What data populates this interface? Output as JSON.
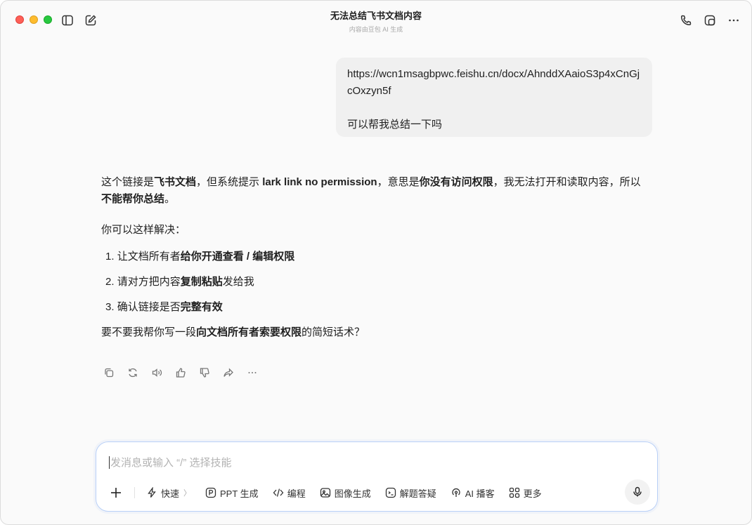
{
  "window": {
    "title": "无法总结飞书文档内容",
    "subtitle": "内容由豆包 AI 生成"
  },
  "user_message": {
    "link": "https://wcn1msagbpwc.feishu.cn/docx/AhnddXAaioS3p4xCnGjcOxzyn5f",
    "text": "可以帮我总结一下吗"
  },
  "reply": {
    "intro": {
      "t1": "这个链接是",
      "b1": "飞书文档",
      "t2": "，但系统提示 ",
      "b2": "lark link no permission",
      "t3": "，意思是",
      "b3": "你没有访问权限",
      "t4": "，我无法打开和读取内容，所以",
      "b4": "不能帮你总结",
      "t5": "。"
    },
    "how": "你可以这样解决：",
    "steps": [
      {
        "num": "1.",
        "pre": "让文档所有者",
        "bold": "给你开通查看 / 编辑权限",
        "post": ""
      },
      {
        "num": "2.",
        "pre": "请对方把内容",
        "bold": "复制粘贴",
        "post": "发给我"
      },
      {
        "num": "3.",
        "pre": "确认链接是否",
        "bold": "完整有效",
        "post": ""
      }
    ],
    "ask": {
      "pre": "要不要我帮你写一段",
      "bold": "向文档所有者索要权限",
      "post": "的简短话术？"
    }
  },
  "composer": {
    "placeholder": "发消息或输入 “/” 选择技能",
    "tools": {
      "quick": "快速",
      "ppt": "PPT 生成",
      "code": "编程",
      "image": "图像生成",
      "solve": "解题答疑",
      "podcast": "AI 播客",
      "more": "更多"
    }
  },
  "icons": {
    "sidebar": "sidebar-toggle-icon",
    "compose": "new-chat-icon",
    "phone": "phone-icon",
    "window": "floating-window-icon",
    "more": "more-icon"
  }
}
